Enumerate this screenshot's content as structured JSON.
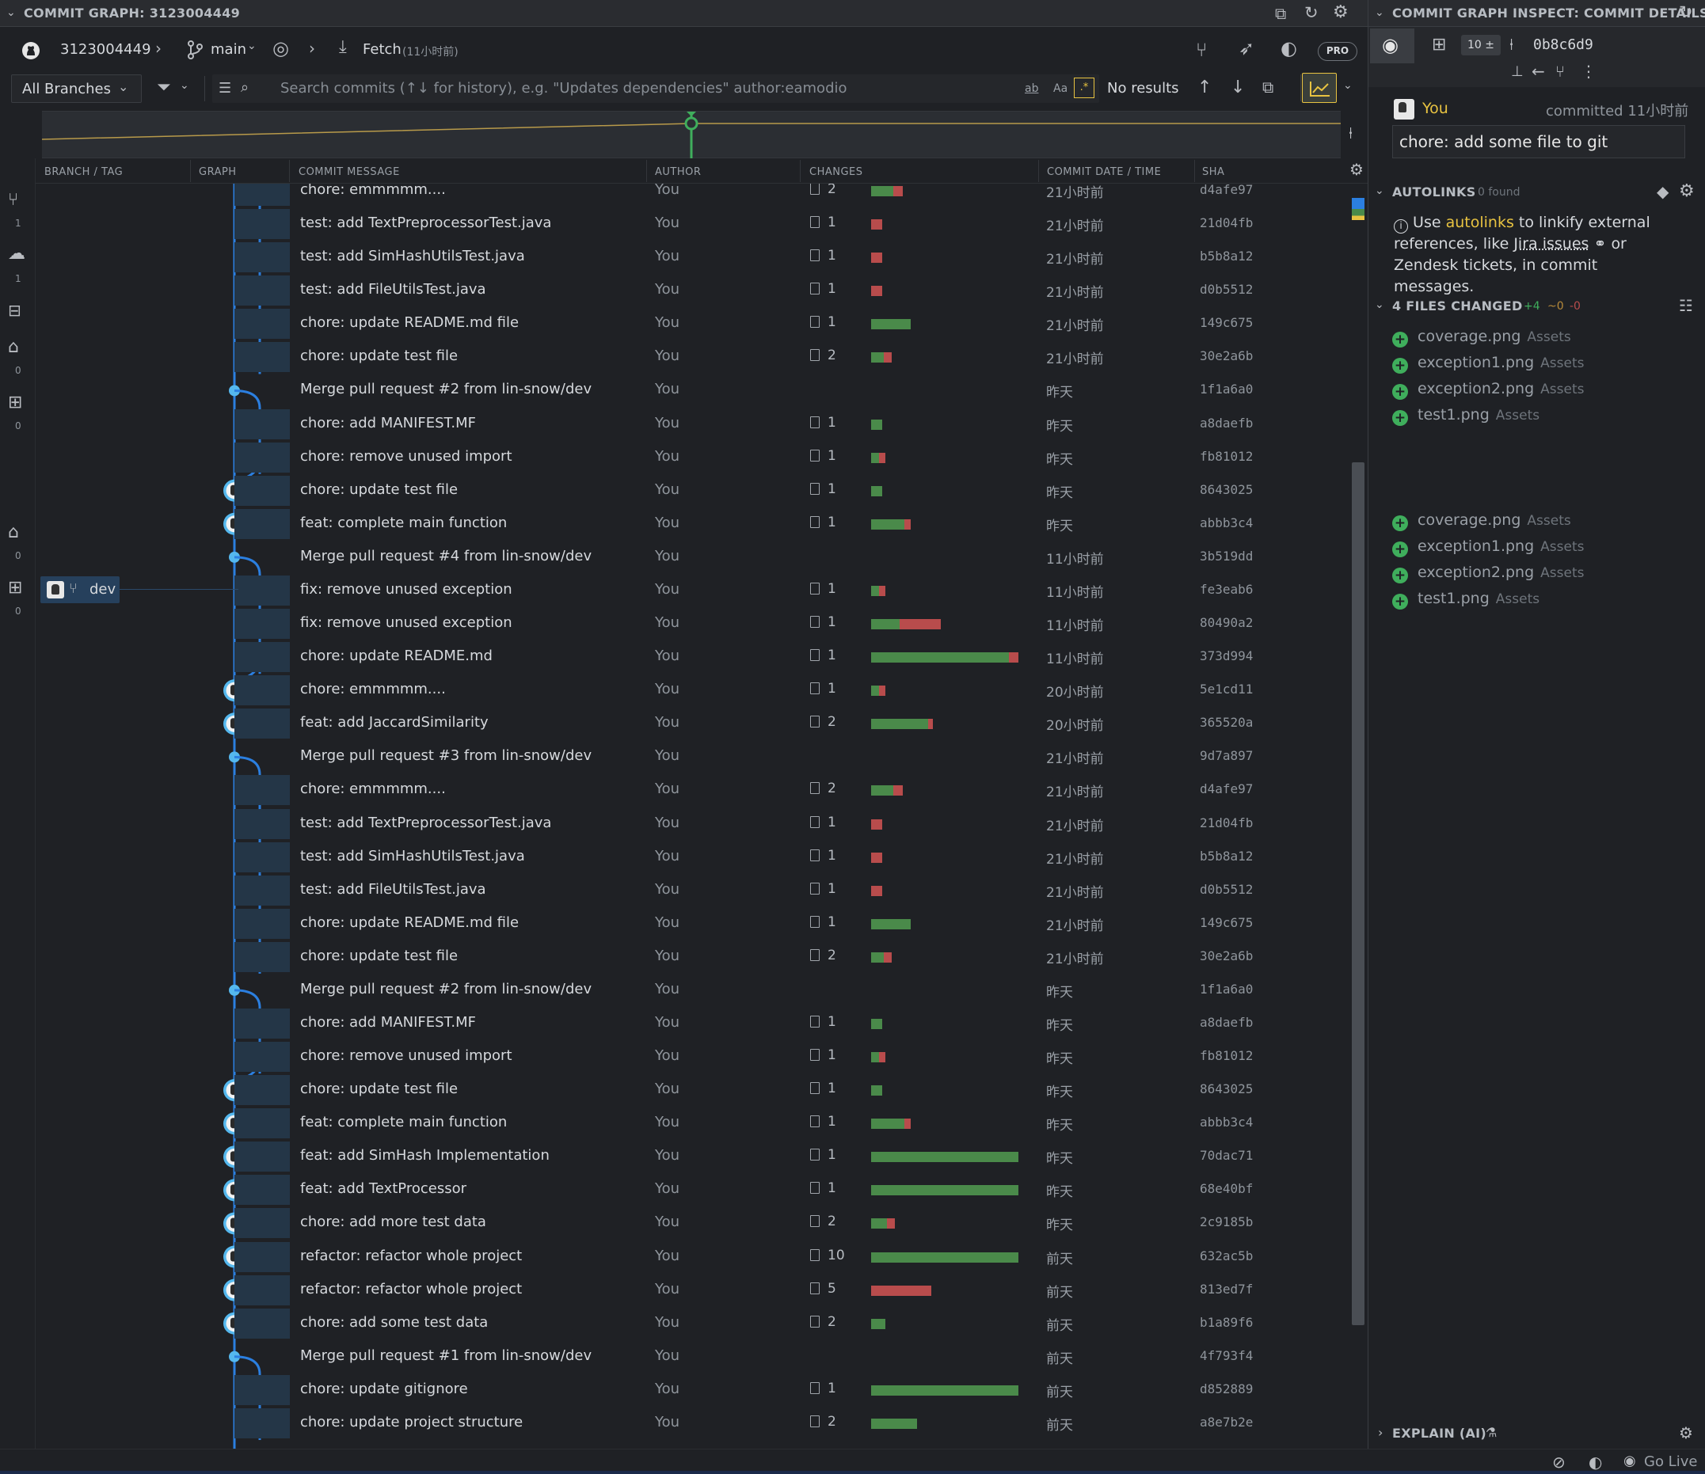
{
  "graph_panel": {
    "title": "COMMIT GRAPH: 3123004449",
    "repo": "3123004449",
    "branch": "main",
    "fetch_label": "Fetch",
    "fetch_time": "(11小时前)",
    "pro_badge": "PRO",
    "branch_filter": "All Branches",
    "search_placeholder": "Search commits (↑↓ for history), e.g. \"Updates dependencies\" author:eamodio",
    "search_opt_word": "ab",
    "search_opt_case": "Aa",
    "search_opt_regex": ".*",
    "search_results": "No results"
  },
  "columns": {
    "branch_tag": "BRANCH / TAG",
    "graph": "GRAPH",
    "message": "COMMIT MESSAGE",
    "author": "AUTHOR",
    "changes": "CHANGES",
    "date": "COMMIT DATE / TIME",
    "sha": "SHA"
  },
  "activity_counts": {
    "branches": "1",
    "remotes": "1",
    "tags": "0",
    "worktrees": "0",
    "tags2": "0",
    "worktrees2": "0"
  },
  "branch_label": "dev",
  "commits": [
    {
      "msg": "chore: emmmmm....",
      "author": "You",
      "files": "2",
      "g": 28,
      "r": 12,
      "date": "21小时前",
      "sha": "d4afe97",
      "node": "a"
    },
    {
      "msg": "test: add TextPreprocessorTest.java",
      "author": "You",
      "files": "1",
      "g": 0,
      "r": 14,
      "date": "21小时前",
      "sha": "21d04fb",
      "node": "a"
    },
    {
      "msg": "test: add SimHashUtilsTest.java",
      "author": "You",
      "files": "1",
      "g": 0,
      "r": 14,
      "date": "21小时前",
      "sha": "b5b8a12",
      "node": "a"
    },
    {
      "msg": "test: add FileUtilsTest.java",
      "author": "You",
      "files": "1",
      "g": 0,
      "r": 14,
      "date": "21小时前",
      "sha": "d0b5512",
      "node": "a"
    },
    {
      "msg": "chore: update README.md file",
      "author": "You",
      "files": "1",
      "g": 50,
      "r": 0,
      "date": "21小时前",
      "sha": "149c675",
      "node": "a"
    },
    {
      "msg": "chore: update test file",
      "author": "You",
      "files": "2",
      "g": 16,
      "r": 10,
      "date": "21小时前",
      "sha": "30e2a6b",
      "node": "a"
    },
    {
      "msg": "Merge pull request #2 from lin-snow/dev",
      "author": "You",
      "files": "",
      "g": 0,
      "r": 0,
      "date": "昨天",
      "sha": "1f1a6a0",
      "node": "m"
    },
    {
      "msg": "chore: add MANIFEST.MF",
      "author": "You",
      "files": "1",
      "g": 14,
      "r": 0,
      "date": "昨天",
      "sha": "a8daefb",
      "node": "a"
    },
    {
      "msg": "chore: remove unused import",
      "author": "You",
      "files": "1",
      "g": 10,
      "r": 8,
      "date": "昨天",
      "sha": "fb81012",
      "node": "a"
    },
    {
      "msg": "chore: update test file",
      "author": "You",
      "files": "1",
      "g": 14,
      "r": 0,
      "date": "昨天",
      "sha": "8643025",
      "node": "b"
    },
    {
      "msg": "feat: complete main function",
      "author": "You",
      "files": "1",
      "g": 42,
      "r": 8,
      "date": "昨天",
      "sha": "abbb3c4",
      "node": "b"
    },
    {
      "msg": "Merge pull request #4 from lin-snow/dev",
      "author": "You",
      "files": "",
      "g": 0,
      "r": 0,
      "date": "11小时前",
      "sha": "3b519dd",
      "node": "m"
    },
    {
      "msg": "fix: remove unused exception",
      "author": "You",
      "files": "1",
      "g": 10,
      "r": 8,
      "date": "11小时前",
      "sha": "fe3eab6",
      "node": "a"
    },
    {
      "msg": "fix: remove unused exception",
      "author": "You",
      "files": "1",
      "g": 36,
      "r": 52,
      "date": "11小时前",
      "sha": "80490a2",
      "node": "a"
    },
    {
      "msg": "chore: update README.md",
      "author": "You",
      "files": "1",
      "g": 174,
      "r": 12,
      "date": "11小时前",
      "sha": "373d994",
      "node": "a"
    },
    {
      "msg": "chore: emmmmm....",
      "author": "You",
      "files": "1",
      "g": 10,
      "r": 8,
      "date": "20小时前",
      "sha": "5e1cd11",
      "node": "b"
    },
    {
      "msg": "feat: add JaccardSimilarity",
      "author": "You",
      "files": "2",
      "g": 72,
      "r": 6,
      "date": "20小时前",
      "sha": "365520a",
      "node": "b"
    },
    {
      "msg": "Merge pull request #3 from lin-snow/dev",
      "author": "You",
      "files": "",
      "g": 0,
      "r": 0,
      "date": "21小时前",
      "sha": "9d7a897",
      "node": "m"
    },
    {
      "msg": "chore: emmmmm....",
      "author": "You",
      "files": "2",
      "g": 28,
      "r": 12,
      "date": "21小时前",
      "sha": "d4afe97",
      "node": "a"
    },
    {
      "msg": "test: add TextPreprocessorTest.java",
      "author": "You",
      "files": "1",
      "g": 0,
      "r": 14,
      "date": "21小时前",
      "sha": "21d04fb",
      "node": "a"
    },
    {
      "msg": "test: add SimHashUtilsTest.java",
      "author": "You",
      "files": "1",
      "g": 0,
      "r": 14,
      "date": "21小时前",
      "sha": "b5b8a12",
      "node": "a"
    },
    {
      "msg": "test: add FileUtilsTest.java",
      "author": "You",
      "files": "1",
      "g": 0,
      "r": 14,
      "date": "21小时前",
      "sha": "d0b5512",
      "node": "a"
    },
    {
      "msg": "chore: update README.md file",
      "author": "You",
      "files": "1",
      "g": 50,
      "r": 0,
      "date": "21小时前",
      "sha": "149c675",
      "node": "a"
    },
    {
      "msg": "chore: update test file",
      "author": "You",
      "files": "2",
      "g": 16,
      "r": 10,
      "date": "21小时前",
      "sha": "30e2a6b",
      "node": "a"
    },
    {
      "msg": "Merge pull request #2 from lin-snow/dev",
      "author": "You",
      "files": "",
      "g": 0,
      "r": 0,
      "date": "昨天",
      "sha": "1f1a6a0",
      "node": "m"
    },
    {
      "msg": "chore: add MANIFEST.MF",
      "author": "You",
      "files": "1",
      "g": 14,
      "r": 0,
      "date": "昨天",
      "sha": "a8daefb",
      "node": "a"
    },
    {
      "msg": "chore: remove unused import",
      "author": "You",
      "files": "1",
      "g": 10,
      "r": 8,
      "date": "昨天",
      "sha": "fb81012",
      "node": "a"
    },
    {
      "msg": "chore: update test file",
      "author": "You",
      "files": "1",
      "g": 14,
      "r": 0,
      "date": "昨天",
      "sha": "8643025",
      "node": "b"
    },
    {
      "msg": "feat: complete main function",
      "author": "You",
      "files": "1",
      "g": 42,
      "r": 8,
      "date": "昨天",
      "sha": "abbb3c4",
      "node": "b"
    },
    {
      "msg": "feat: add SimHash Implementation",
      "author": "You",
      "files": "1",
      "g": 186,
      "r": 0,
      "date": "昨天",
      "sha": "70dac71",
      "node": "b"
    },
    {
      "msg": "feat: add TextProcessor",
      "author": "You",
      "files": "1",
      "g": 186,
      "r": 0,
      "date": "昨天",
      "sha": "68e40bf",
      "node": "b"
    },
    {
      "msg": "chore: add more test data",
      "author": "You",
      "files": "2",
      "g": 20,
      "r": 10,
      "date": "昨天",
      "sha": "2c9185b",
      "node": "b"
    },
    {
      "msg": "refactor: refactor whole project",
      "author": "You",
      "files": "10",
      "g": 186,
      "r": 0,
      "date": "前天",
      "sha": "632ac5b",
      "node": "b"
    },
    {
      "msg": "refactor: refactor whole project",
      "author": "You",
      "files": "5",
      "g": 0,
      "r": 76,
      "date": "前天",
      "sha": "813ed7f",
      "node": "b"
    },
    {
      "msg": "chore: add some test data",
      "author": "You",
      "files": "2",
      "g": 18,
      "r": 0,
      "date": "前天",
      "sha": "b1a89f6",
      "node": "b"
    },
    {
      "msg": "Merge pull request #1 from lin-snow/dev",
      "author": "You",
      "files": "",
      "g": 0,
      "r": 0,
      "date": "前天",
      "sha": "4f793f4",
      "node": "m"
    },
    {
      "msg": "chore: update gitignore",
      "author": "You",
      "files": "1",
      "g": 186,
      "r": 0,
      "date": "前天",
      "sha": "d852889",
      "node": "a"
    },
    {
      "msg": "chore: update project structure",
      "author": "You",
      "files": "2",
      "g": 58,
      "r": 0,
      "date": "前天",
      "sha": "a8e7b2e",
      "node": "a"
    }
  ],
  "details_panel": {
    "title": "COMMIT GRAPH INSPECT: COMMIT DETAILS",
    "changes_badge": "10 ±",
    "sha": "0b8c6d9",
    "author": "You",
    "committed": "committed 11小时前",
    "message": "chore: add some file to git",
    "autolinks_title": "AUTOLINKS",
    "autolinks_found": "0 found",
    "autolinks_text_1": "Use",
    "autolinks_link": "autolinks",
    "autolinks_text_2": "to linkify external references, like",
    "autolinks_jira": "Jira issues",
    "autolinks_text_3": "or Zendesk tickets, in commit messages.",
    "files_title": "4 FILES CHANGED",
    "files_added": "+4",
    "files_changed": "~0",
    "files_removed": "-0",
    "files": [
      {
        "name": "coverage.png",
        "dir": "Assets"
      },
      {
        "name": "exception1.png",
        "dir": "Assets"
      },
      {
        "name": "exception2.png",
        "dir": "Assets"
      },
      {
        "name": "test1.png",
        "dir": "Assets"
      }
    ],
    "explain_title": "EXPLAIN (AI)"
  },
  "status_bar": {
    "go_live": "Go Live"
  },
  "colors": {
    "accent": "#2b7fe0",
    "node_ring": "#55b8ee",
    "added": "#4a8a4a",
    "removed": "#b84c4c",
    "highlight": "#e8c341"
  }
}
